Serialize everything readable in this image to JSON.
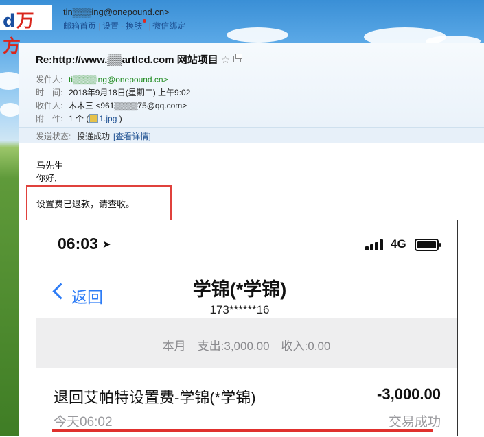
{
  "account": {
    "logo_text_part": "d",
    "logo_text": "万方",
    "email": "tin▒▒▒ing@onepound.cn>",
    "nav": [
      "邮箱首页",
      "设置",
      "换肤",
      "微信绑定"
    ],
    "nav_sep": "|",
    "nav_dash": "-"
  },
  "mail": {
    "subject": "Re:http://www.▒▒artlcd.com 网站项目",
    "from_label": "发件人:",
    "from_value": "ti▒▒▒▒ing@onepound.cn>",
    "time_label": "时　间:",
    "time_value": "2018年9月18日(星期二) 上午9:02",
    "to_label": "收件人:",
    "to_value": "木木三 <961▒▒▒▒75@qq.com>",
    "attach_label": "附　件:",
    "attach_count": "1 个 (",
    "attach_name": "1.jpg",
    "attach_close": " )",
    "status_label": "发送状态:",
    "status_value": "投递成功",
    "status_link": "[查看详情]",
    "body_line1": "马先生",
    "body_line2": "你好,",
    "body_line3": "设置费已退款，请查收。"
  },
  "phone": {
    "time": "06:03",
    "network": "4G",
    "back_label": "返回",
    "title": "学锦(*学锦)",
    "subtitle": "173******16",
    "summary": "本月　支出:3,000.00　收入:0.00",
    "txn_title": "退回艾帕特设置费-学锦(*学锦)",
    "txn_amount": "-3,000.00",
    "txn_time": "今天06:02",
    "txn_status": "交易成功"
  },
  "colors": {
    "accent_link": "#1d4f91",
    "ios_blue": "#2d7cf6",
    "highlight_red": "#e0413c"
  }
}
